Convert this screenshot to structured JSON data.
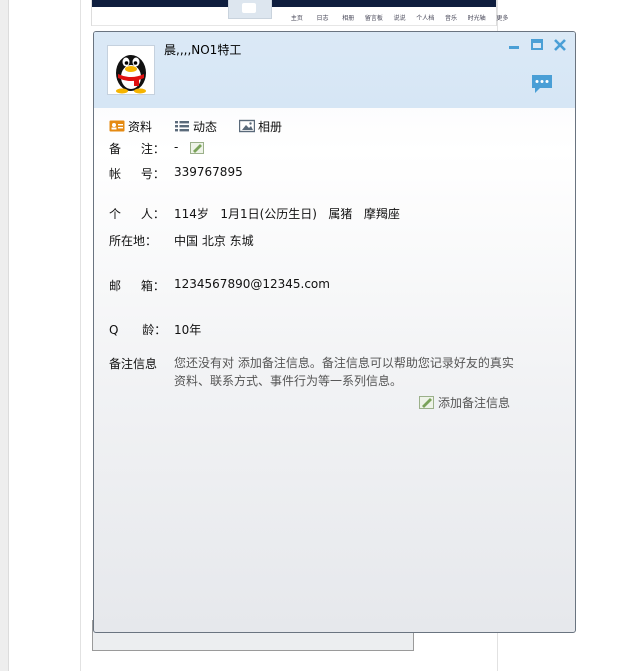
{
  "background_page": {
    "nav_items": [
      "主页",
      "日志",
      "相册",
      "留言板",
      "说说",
      "个人档",
      "音乐",
      "时光轴",
      "更多"
    ]
  },
  "profile": {
    "nickname": "晨,,,,NO1特工",
    "avatar_icon": "penguin-avatar-icon"
  },
  "window_controls": {
    "minimize_icon": "minimize-icon",
    "maximize_icon": "maximize-icon",
    "close_icon": "close-icon",
    "chat_icon": "chat-bubble-icon"
  },
  "tabs": [
    {
      "label": "资料",
      "icon": "id-card-icon"
    },
    {
      "label": "动态",
      "icon": "list-icon"
    },
    {
      "label": "相册",
      "icon": "photo-icon"
    }
  ],
  "fields": {
    "memo": {
      "label_a": "备",
      "label_b": "注：",
      "value": "-"
    },
    "account": {
      "label_a": "帐",
      "label_b": "号：",
      "value": "339767895"
    },
    "personal": {
      "label_a": "个",
      "label_b": "人：",
      "value": "114岁   1月1日(公历生日)   属猪   摩羯座"
    },
    "location": {
      "label": "所在地：",
      "value": "中国 北京 东城"
    },
    "email": {
      "label_a": "邮",
      "label_b": "箱：",
      "value": "1234567890@12345.com"
    },
    "q_age": {
      "label_a": "Q",
      "label_b": "龄：",
      "value": "10年"
    },
    "note": {
      "label": "备注信息",
      "text": "您还没有对 添加备注信息。备注信息可以帮助您记录好友的真实资料、联系方式、事件行为等一系列信息。",
      "add_label": "添加备注信息"
    }
  },
  "colors": {
    "header_bg": "#d6e6f5",
    "accent_blue": "#4a9fd6",
    "tab_icon_orange": "#e58a12"
  }
}
